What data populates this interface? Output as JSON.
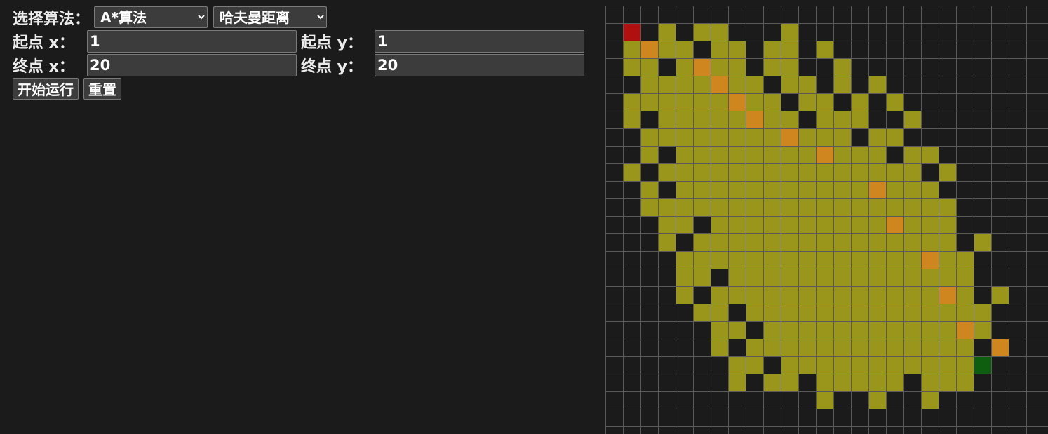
{
  "controls": {
    "algo_label": "选择算法：",
    "algorithm_select": {
      "selected": "A*算法",
      "options": [
        "A*算法"
      ]
    },
    "heuristic_select": {
      "selected": "哈夫曼距离",
      "options": [
        "哈夫曼距离"
      ]
    },
    "start_x_label": "起点 x：",
    "start_x_value": "1",
    "start_y_label": "起点 y：",
    "start_y_value": "1",
    "end_x_label": "终点 x：",
    "end_x_value": "20",
    "end_y_label": "终点 y：",
    "end_y_value": "20",
    "run_button": "开始运行",
    "reset_button": "重置"
  },
  "grid": {
    "colors": {
      "background": "#1b1b1b",
      "grid_line": "#5a5a5a",
      "explored": "#9a961b",
      "path": "#d0861f",
      "start": "#b01010",
      "end": "#0f5e0f"
    },
    "start": [
      1,
      1
    ],
    "end": [
      20,
      20
    ],
    "rows": [
      "------------------------",
      "-S-E-EE---E-------------",
      "-EPEE-EE-EE-E-----------",
      "-EE-EPEE-EE--E----------",
      "--EEEEPEE-EE-E-E--------",
      "-EEEEEEPEE-EE-E-E-------",
      "-E-EEEEEPEE-EEE--E------",
      "--EEEEEEEEPEEE-EE-------",
      "--E-EEEEEEEEPEEE-EE-----",
      "-E-EEEEEEEEEEEEEEE-E----",
      "--E-EEEEEEEEEEEPEEE-----",
      "--EEEEEEEEEEEEEEEEEE----",
      "---EE-EEEEEEEEEEPEEE----",
      "---E-EEEEEEEEEEEEEEE-E--",
      "----EEEEEEEEEEEEEEPEE---",
      "----EE-EEEEEEEEEEEEEE---",
      "----E-EEEEEEEEEEEEEPE-E-",
      "-----EE-EEEEEEEEEEEEEE--",
      "------EE-EEEEEEEEEEEPE--",
      "------E-EEEEEEEEEEEEE-P-",
      "-------EE-EEEEEEEEEEEX--",
      "-------E-EE-EEEEE-EEE---",
      "------------E--E--E-----",
      "------------------------",
      "------------------------"
    ]
  }
}
